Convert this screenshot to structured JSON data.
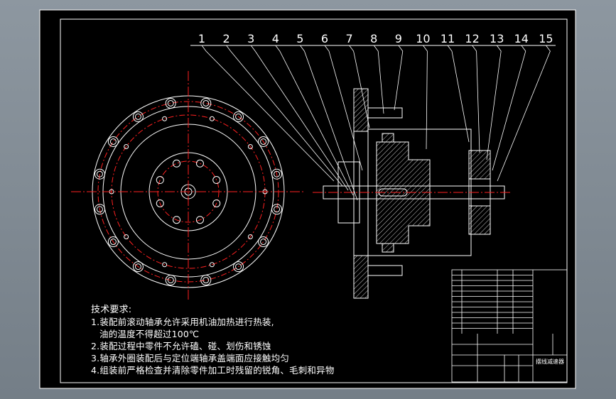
{
  "colors": {
    "background": "#000000",
    "frame": "#ffffff",
    "centerline": "#ff2020",
    "geometry": "#ffffff",
    "leader": "#ffffff",
    "text": "#ffffff",
    "viewport": "#7e8891"
  },
  "part_numbers": [
    "1",
    "2",
    "3",
    "4",
    "5",
    "6",
    "7",
    "8",
    "9",
    "10",
    "11",
    "12",
    "13",
    "14",
    "15"
  ],
  "technical_requirements": {
    "title": "技术要求:",
    "items": [
      "1.装配前滚动轴承允许采用机油加热进行热装,",
      "油的温度不得超过100℃",
      "2.装配过程中零件不允许磕、碰、划伤和锈蚀",
      "3.轴承外圈装配后与定位端轴承盖端面应接触均匀",
      "4.组装前严格检查并清除零件加工时残留的锐角、毛刺和异物"
    ]
  },
  "title_block": {
    "drawing_name": "摆线减速器"
  }
}
